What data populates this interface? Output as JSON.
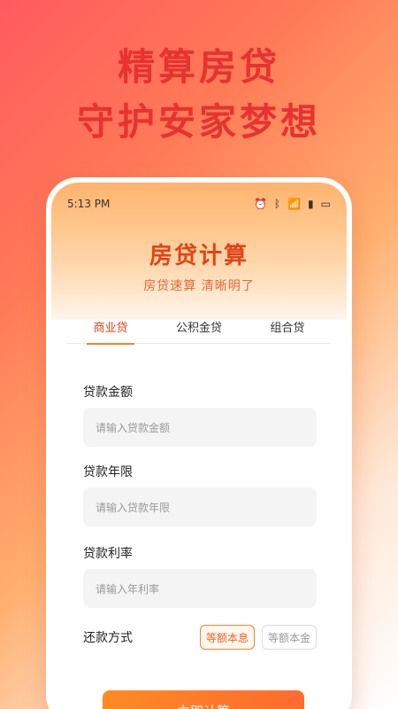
{
  "hero": {
    "line1": "精算房贷",
    "line2": "守护安家梦想"
  },
  "status_bar": {
    "time": "5:13 PM",
    "icons": [
      "alarm-icon",
      "bluetooth-icon",
      "wifi-icon",
      "signal-icon",
      "battery-icon"
    ]
  },
  "header": {
    "title": "房贷计算",
    "subtitle": "房贷速算 清晰明了"
  },
  "tabs": [
    {
      "label": "商业贷",
      "active": true
    },
    {
      "label": "公积金贷",
      "active": false
    },
    {
      "label": "组合贷",
      "active": false
    }
  ],
  "form": {
    "loan_amount_label": "贷款金额",
    "loan_amount_placeholder": "请输入贷款金额",
    "loan_term_label": "贷款年限",
    "loan_term_placeholder": "请输入贷款年限",
    "loan_rate_label": "贷款利率",
    "loan_rate_placeholder": "请输入年利率",
    "repay_label": "还款方式",
    "repay_options": [
      {
        "label": "等额本息",
        "selected": true
      },
      {
        "label": "等额本金",
        "selected": false
      }
    ],
    "submit_label": "立即计算"
  },
  "colors": {
    "accent": "#ff7a2a",
    "title": "#e54216",
    "hero_text": "#e7332f"
  }
}
